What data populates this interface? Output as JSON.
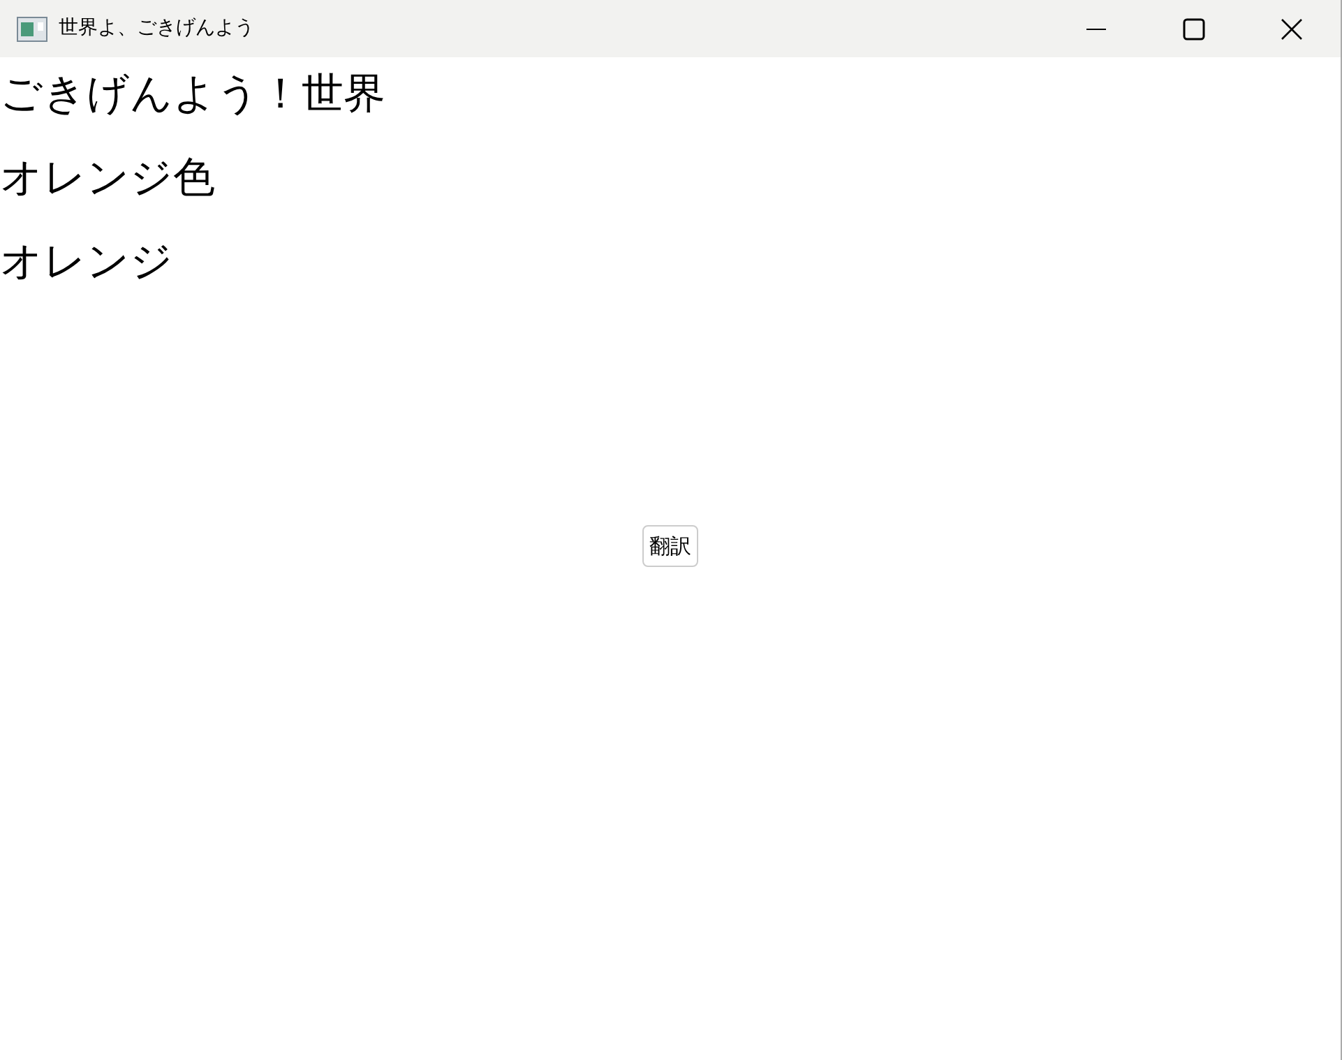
{
  "window": {
    "title": "世界よ、ごきげんよう"
  },
  "labels": [
    "ごきげんよう！世界",
    "オレンジ色",
    "オレンジ"
  ],
  "button": {
    "label": "翻訳"
  }
}
